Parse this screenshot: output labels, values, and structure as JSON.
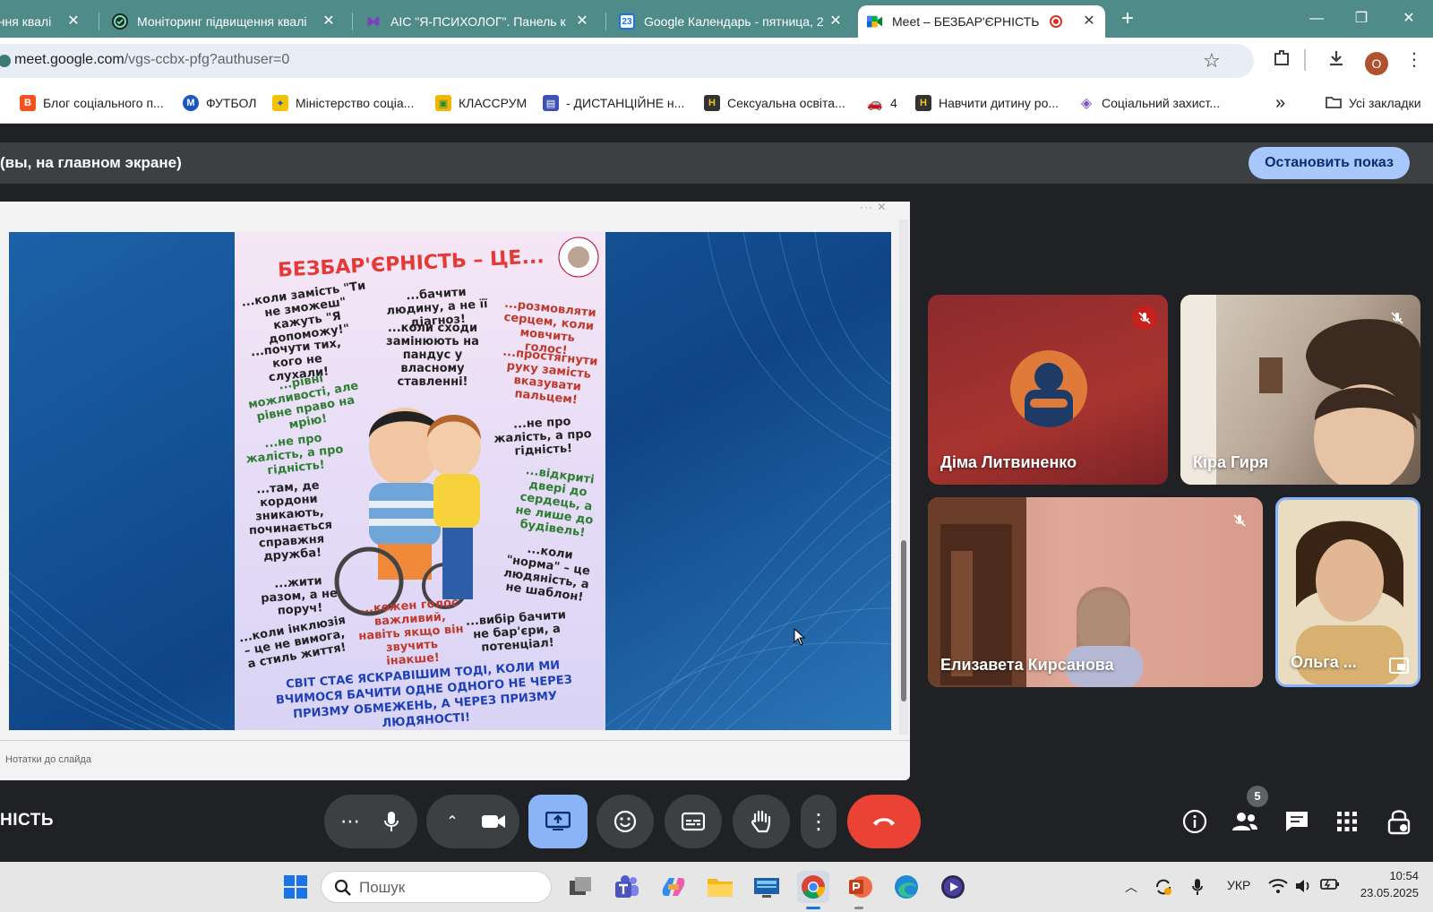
{
  "browser": {
    "tabs": [
      {
        "title": "ення квалі",
        "icon": "document-icon"
      },
      {
        "title": "Моніторинг підвищення квалі",
        "icon": "shield-icon"
      },
      {
        "title": "АІС \"Я-ПСИХОЛОГ\". Панель к",
        "icon": "butterfly-icon"
      },
      {
        "title": "Google Календарь - пятница, 2",
        "icon": "calendar-icon"
      },
      {
        "title": "Meet – БЕЗБАР'ЄРНІСТЬ",
        "icon": "meet-icon",
        "active": true
      }
    ],
    "calendar_day": "23",
    "url_host": "meet.google.com",
    "url_path": "/vgs-ccbx-pfg?authuser=0",
    "profile_initial": "O",
    "bookmarks": [
      {
        "label": "Блог соціального п...",
        "color": "#f4511e",
        "glyph": "B"
      },
      {
        "label": "ФУТБОЛ",
        "color": "#1a56c4",
        "glyph": "M"
      },
      {
        "label": "Міністерство соціа...",
        "color": "#f2c200",
        "glyph": "✦"
      },
      {
        "label": "КЛАССРУМ",
        "color": "#f2b600",
        "glyph": "▣"
      },
      {
        "label": "- ДИСТАНЦІЙНЕ н...",
        "color": "#3f51b5",
        "glyph": "▤"
      },
      {
        "label": "Сексуальна освіта...",
        "color": "#333333",
        "glyph": "H"
      },
      {
        "label": "4",
        "color": "#e53935",
        "glyph": "🚗"
      },
      {
        "label": "Навчити дитину ро...",
        "color": "#333333",
        "glyph": "H"
      },
      {
        "label": "Соціальний захист...",
        "color": "#7e57c2",
        "glyph": "◈"
      }
    ],
    "bookmarks_more": "»",
    "all_bookmarks": "Усі закладки"
  },
  "meet": {
    "presenting_text": "(вы, на главном экране)",
    "stop_button": "Остановить показ",
    "slide_notes": "Нотатки до слайда",
    "meeting_name": "НІСТЬ",
    "participants_count": "5",
    "participants": [
      {
        "name": "Діма Литвиненко",
        "muted": true,
        "mute_style": "red"
      },
      {
        "name": "Кіра Гиря",
        "muted": true,
        "mute_style": "plain"
      },
      {
        "name": "Елизавета Кирсанова",
        "muted": true,
        "mute_style": "plain"
      },
      {
        "name": "Ольга ...",
        "muted": false
      }
    ]
  },
  "poster": {
    "title": "БЕЗБАР'ЄРНІСТЬ – ЦЕ...",
    "phrases": [
      "...коли замість \"Ти не зможеш\" кажуть \"Я допоможу!\"",
      "...бачити людину, а не її діагноз!",
      "...розмовляти серцем, коли мовчить голос!",
      "...почути тих, кого не слухали!",
      "...коли сходи замінюють на пандус у власному ставленні!",
      "...простягнути руку замість вказувати пальцем!",
      "...рівні можливості, але рівне право на мрію!",
      "...не про жалість, а про гідність!",
      "...не про жалість, а про гідність!",
      "...відкриті двері до сердець, а не лише до будівель!",
      "...там, де кордони зникають, починається справжня дружба!",
      "...коли \"норма\" – це людяність, а не шаблон!",
      "...жити разом, а не поруч!",
      "...кожен голос важливий, навіть якщо він звучить інакше!",
      "...вибір бачити не бар'єри, а потенціал!",
      "...коли інклюзія – це не вимога, а стиль життя!"
    ],
    "footer": "СВІТ СТАЄ ЯСКРАВІШИМ ТОДІ, КОЛИ МИ ВЧИМОСЯ БАЧИТИ ОДНЕ ОДНОГО НЕ ЧЕРЕЗ ПРИЗМУ ОБМЕЖЕНЬ, А ЧЕРЕЗ ПРИЗМУ ЛЮДЯНОСТІ!"
  },
  "taskbar": {
    "search_placeholder": "Пошук",
    "language": "УКР",
    "time": "10:54",
    "date": "23.05.2025"
  },
  "colors": {
    "tabstrip": "#4f8b88",
    "meet_bg": "#202124",
    "stop_button": "#a8c7fa",
    "present_active": "#8ab4f8",
    "end_call": "#ea4335"
  }
}
